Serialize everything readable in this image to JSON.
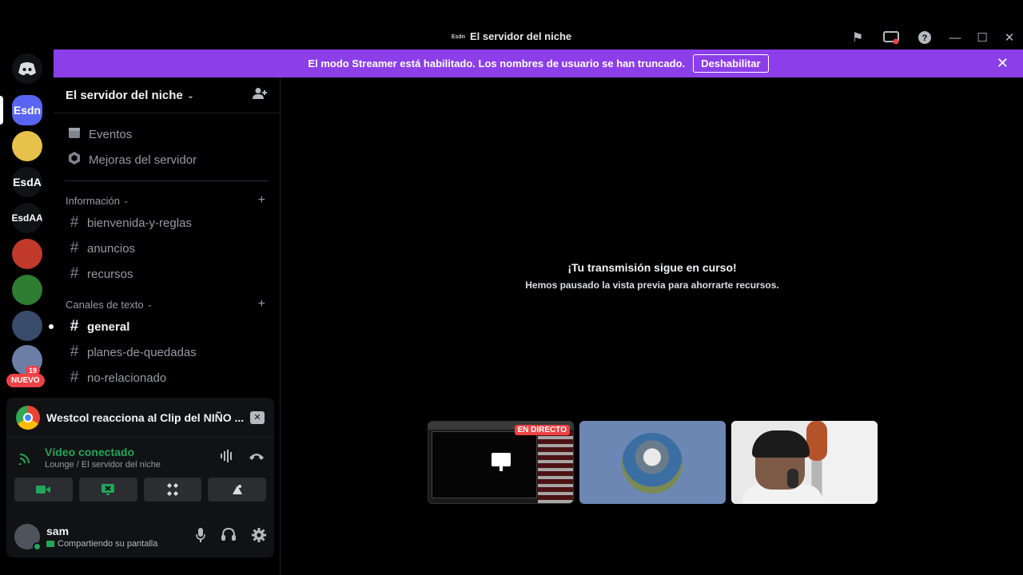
{
  "window": {
    "server_icon_text": "Esdn",
    "title": "El servidor del niche"
  },
  "banner": {
    "text": "El modo Streamer está habilitado. Los nombres de usuario se han truncado.",
    "button": "Deshabilitar"
  },
  "rail": {
    "servers": [
      {
        "label": "Esdn",
        "color": "#5865f2"
      },
      {
        "label": "",
        "color": "#e7c24a"
      },
      {
        "label": "EsdA",
        "color": "#111214"
      },
      {
        "label": "EsdAA",
        "color": "#111214"
      },
      {
        "label": "",
        "color": "#c0392b"
      },
      {
        "label": "",
        "color": "#2e7d32"
      },
      {
        "label": "",
        "color": "#3a4c6b"
      },
      {
        "label": "",
        "color": "#6c7ea6"
      }
    ],
    "mention_count": "19",
    "new_label": "NUEVO"
  },
  "sidebar": {
    "server_name": "El servidor del niche",
    "items": [
      {
        "label": "Eventos",
        "icon": "calendar-icon"
      },
      {
        "label": "Mejoras del servidor",
        "icon": "boost-icon"
      }
    ],
    "categories": [
      {
        "name": "Información",
        "channels": [
          "bienvenida-y-reglas",
          "anuncios",
          "recursos"
        ]
      },
      {
        "name": "Canales de texto",
        "channels": [
          "general",
          "planes-de-quedadas",
          "no-relacionado"
        ]
      }
    ],
    "active_channel": "general"
  },
  "panel": {
    "activity_title": "Westcol reacciona al Clip del NIÑO ...",
    "voice_status": "Vídeo conectado",
    "voice_location": "Lounge / El servidor del niche",
    "username": "sam",
    "user_status": "Compartiendo su pantalla"
  },
  "main": {
    "title": "¡Tu transmisión sigue en curso!",
    "subtitle": "Hemos pausado la vista previa para ahorrarte recursos.",
    "live_badge": "EN DIRECTO"
  },
  "colors": {
    "banner": "#8c3fe8",
    "connected": "#23a55a",
    "live": "#ed4245"
  }
}
